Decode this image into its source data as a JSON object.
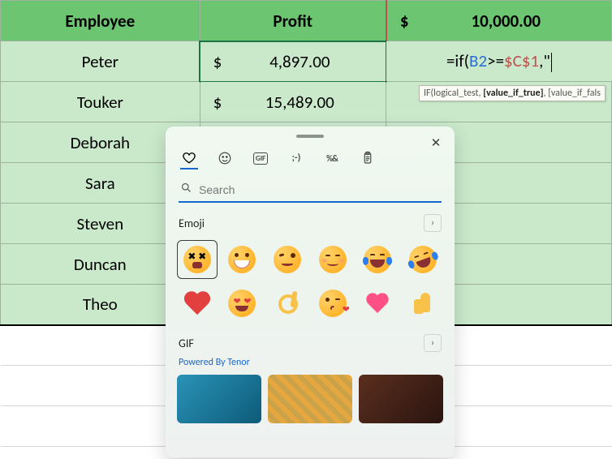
{
  "headers": {
    "a": "Employee",
    "b": "Profit",
    "c_value": "10,000.00"
  },
  "currency": "$",
  "rows": [
    {
      "name": "Peter",
      "profit": "4,897.00"
    },
    {
      "name": "Touker",
      "profit": "15,489.00"
    },
    {
      "name": "Deborah"
    },
    {
      "name": "Sara"
    },
    {
      "name": "Steven"
    },
    {
      "name": "Duncan"
    },
    {
      "name": "Theo"
    }
  ],
  "formula": {
    "prefix": "=if(",
    "ref": "B2",
    "op": ">=",
    "absref": "$C$1",
    "suffix": ",\""
  },
  "tooltip": {
    "fn": "IF(logical_test, ",
    "bold": "[value_if_true]",
    "rest": ", [value_if_fals"
  },
  "picker": {
    "search_placeholder": "Search",
    "sections": {
      "emoji": "Emoji",
      "gif": "GIF"
    },
    "powered": "Powered By Tenor",
    "emoji_names": [
      "tired-face",
      "grinning-face",
      "woozy-face",
      "smiling-face",
      "tears-of-joy",
      "rofl",
      "red-heart",
      "heart-eyes",
      "ok-hand",
      "face-blowing-kiss",
      "growing-heart",
      "thumbs-up"
    ]
  }
}
